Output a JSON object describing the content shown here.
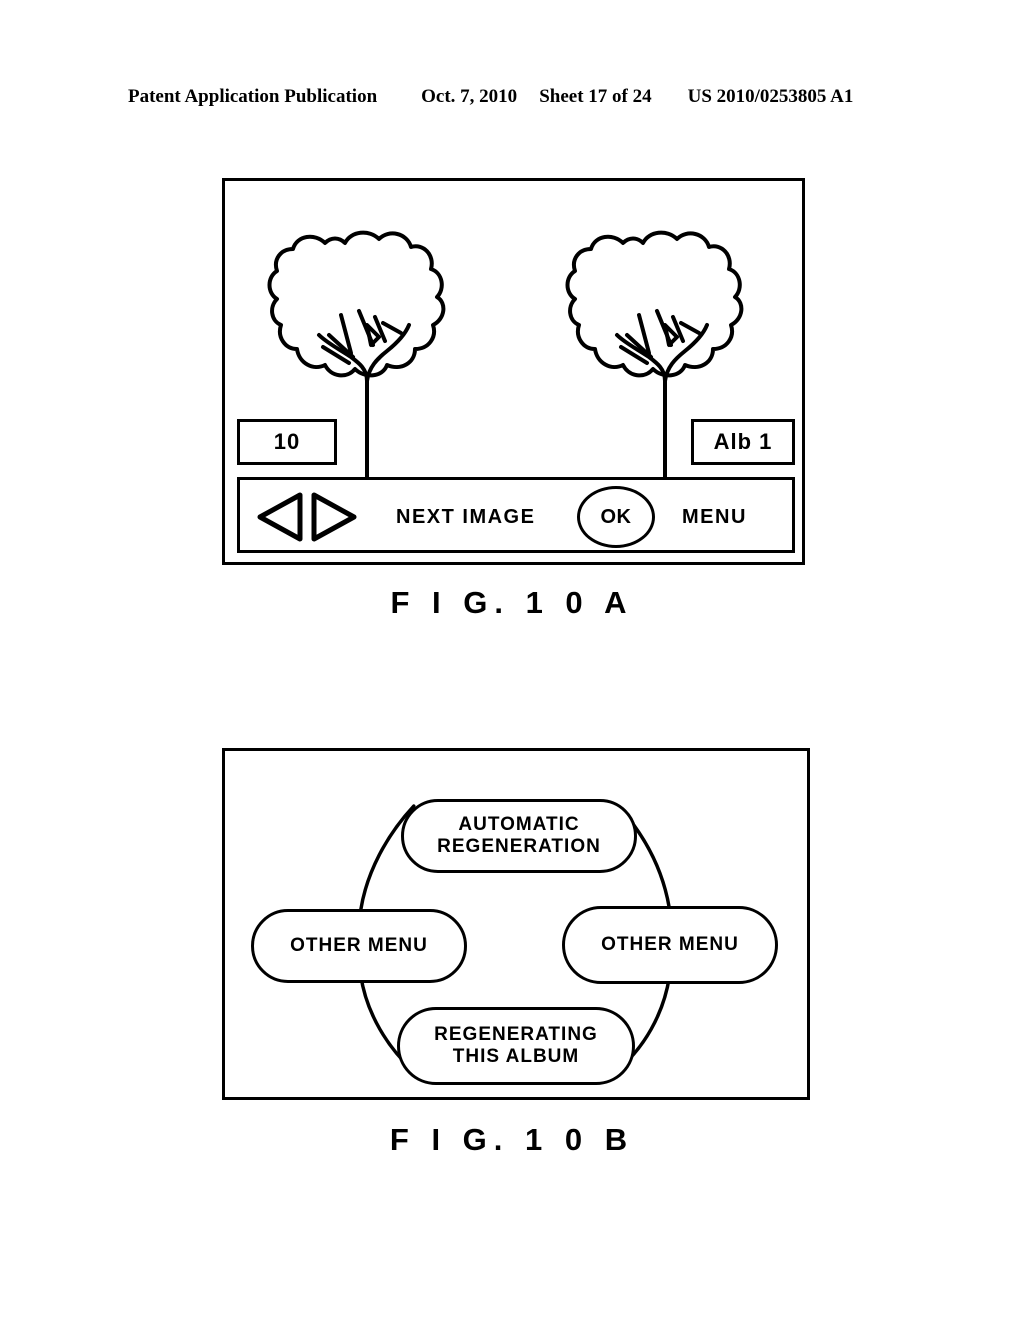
{
  "header": {
    "publication": "Patent Application Publication",
    "date": "Oct. 7, 2010",
    "sheet": "Sheet 17 of 24",
    "number": "US 2010/0253805 A1"
  },
  "figures": [
    {
      "caption": "F I G.  1 0 A",
      "screen": {
        "count_label": "10",
        "album_label": "Alb 1",
        "thumbnails": [
          "tree-image",
          "tree-image"
        ],
        "toolbar": {
          "prev_icon": "triangle-left-icon",
          "next_icon": "triangle-right-icon",
          "next_image_label": "NEXT IMAGE",
          "ok_label": "OK",
          "menu_label": "MENU"
        }
      }
    },
    {
      "caption": "F I G.  1 0 B",
      "menu_wheel": {
        "top": {
          "line1": "AUTOMATIC",
          "line2": "REGENERATION"
        },
        "left": {
          "line1": "OTHER MENU",
          "line2": ""
        },
        "right": {
          "line1": "OTHER MENU",
          "line2": ""
        },
        "bottom": {
          "line1": "REGENERATING",
          "line2": "THIS ALBUM"
        }
      }
    }
  ],
  "colors": {
    "ink": "#000000",
    "paper": "#ffffff"
  }
}
